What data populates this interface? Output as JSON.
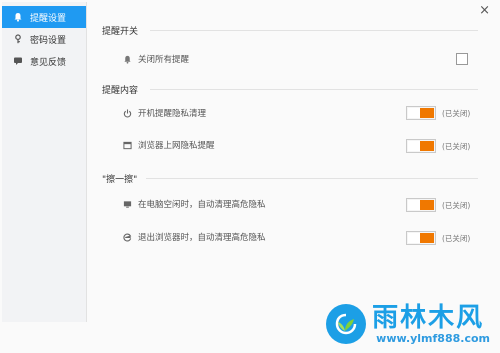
{
  "sidebar": {
    "items": [
      {
        "label": "提醒设置",
        "icon": "bell-icon",
        "active": true
      },
      {
        "label": "密码设置",
        "icon": "key-icon",
        "active": false
      },
      {
        "label": "意见反馈",
        "icon": "chat-icon",
        "active": false
      }
    ]
  },
  "close_label": "×",
  "sections": {
    "switch": {
      "title": "提醒开关",
      "rows": [
        {
          "label": "关闭所有提醒",
          "icon": "bell-icon",
          "checked": false
        }
      ]
    },
    "content": {
      "title": "提醒内容",
      "rows": [
        {
          "label": "开机提醒隐私清理",
          "icon": "power-icon",
          "state": "(已关闭)"
        },
        {
          "label": "浏览器上网隐私提醒",
          "icon": "browser-icon",
          "state": "(已关闭)"
        }
      ]
    },
    "clean": {
      "title": "\"擦一擦\"",
      "rows": [
        {
          "label": "在电脑空闲时，自动清理高危隐私",
          "icon": "monitor-icon",
          "state": "(已关闭)"
        },
        {
          "label": "退出浏览器时，自动清理高危隐私",
          "icon": "ie-icon",
          "state": "(已关闭)"
        }
      ]
    }
  },
  "watermark": {
    "title": "雨林木风",
    "url": "www.ylmf888.com"
  },
  "colors": {
    "accent": "#1f9af2",
    "toggle_orange": "#f07800",
    "watermark_blue": "#1c9fe6"
  }
}
